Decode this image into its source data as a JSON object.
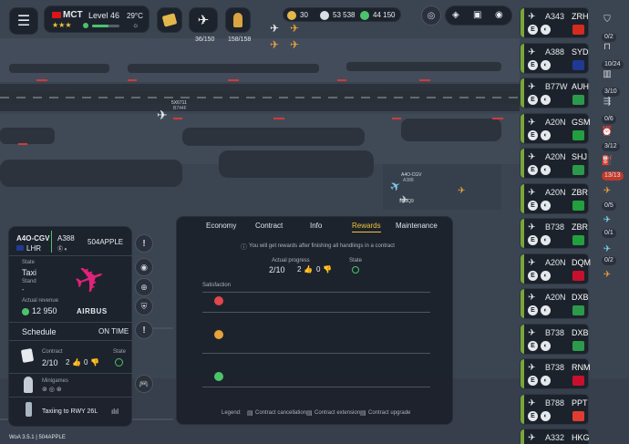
{
  "topbar": {
    "airport_code": "MCT",
    "level": "Level 46",
    "temperature": "29°C",
    "stat1": "36/150",
    "stat2": "158/158",
    "stars_currency": "30",
    "money": "53 538",
    "premium": "44 150"
  },
  "flights": [
    {
      "type": "A343",
      "dest": "ZRH",
      "bar": "#7aa53a",
      "flag": "#d52b1e"
    },
    {
      "type": "A388",
      "dest": "SYD",
      "bar": "#7aa53a",
      "flag": "#1f3a93"
    },
    {
      "type": "B77W",
      "dest": "AUH",
      "bar": "#7aa53a",
      "flag": "#2b9a4b"
    },
    {
      "type": "A20N",
      "dest": "GSM",
      "bar": "#7aa53a",
      "flag": "#239f40"
    },
    {
      "type": "A20N",
      "dest": "SHJ",
      "bar": "#7aa53a",
      "flag": "#2b9a4b"
    },
    {
      "type": "A20N",
      "dest": "ZBR",
      "bar": "#7aa53a",
      "flag": "#239f40"
    },
    {
      "type": "B738",
      "dest": "ZBR",
      "bar": "#7aa53a",
      "flag": "#239f40"
    },
    {
      "type": "A20N",
      "dest": "DQM",
      "bar": "#7aa53a",
      "flag": "#c8102e"
    },
    {
      "type": "A20N",
      "dest": "DXB",
      "bar": "#7aa53a",
      "flag": "#2b9a4b"
    },
    {
      "type": "B738",
      "dest": "DXB",
      "bar": "#7aa53a",
      "flag": "#2b9a4b"
    },
    {
      "type": "B738",
      "dest": "RNM",
      "bar": "#7aa53a",
      "flag": "#c8102e"
    },
    {
      "type": "B788",
      "dest": "PPT",
      "bar": "#7aa53a",
      "flag": "#e03c31"
    },
    {
      "type": "A332",
      "dest": "HKG",
      "bar": "#7aa53a",
      "flag": "#de2910"
    }
  ],
  "side_badges": [
    "0/2",
    "10/24",
    "3/10",
    "0/6",
    "3/12",
    "13/13",
    "0/5",
    "0/1",
    "0/2"
  ],
  "aircraft_panel": {
    "reg": "A4O-CGV",
    "origin": "LHR",
    "type": "A388",
    "callsign": "504APPLE",
    "state_label": "State",
    "state_value": "Taxi",
    "stand_label": "Stand",
    "stand_value": "-",
    "revenue_label": "Actual revenue",
    "revenue_value": "12 950",
    "brand": "AIRBUS",
    "schedule_label": "Schedule",
    "schedule_value": "ON TIME",
    "contract_label": "Contract",
    "contract_value": "2/10",
    "contract_good": "2",
    "contract_bad": "0",
    "contract_state_label": "State",
    "minigames_label": "Minigames",
    "status_text": "Taxiing to RWY 26L"
  },
  "contract_panel": {
    "tabs": [
      "Economy",
      "Contract",
      "Info",
      "Rewards",
      "Maintenance"
    ],
    "active_tab": "Rewards",
    "notice": "You will get rewards after finishing all handlings in a contract",
    "progress_label": "Actual progress",
    "progress_value": "2/10",
    "progress_good": "2",
    "progress_bad": "0",
    "state_label": "State",
    "satisfaction_label": "Satisfaction",
    "legend_label": "Legend:",
    "legend_items": [
      "Contract cancellation",
      "Contract extension",
      "Contract upgrade"
    ]
  },
  "map_labels": {
    "plane1": "5X6711",
    "plane1_sub": "B744F",
    "plane2": "A4O-CGV",
    "plane2_sub": "A388",
    "plane3": "9H8Q9"
  },
  "footer": "WoA 3.5.1 | 504APPLE",
  "colors": {
    "accent": "#f0c33a",
    "good": "#4cc36b",
    "bad": "#e2474b",
    "airbus_pink": "#e0227a"
  }
}
